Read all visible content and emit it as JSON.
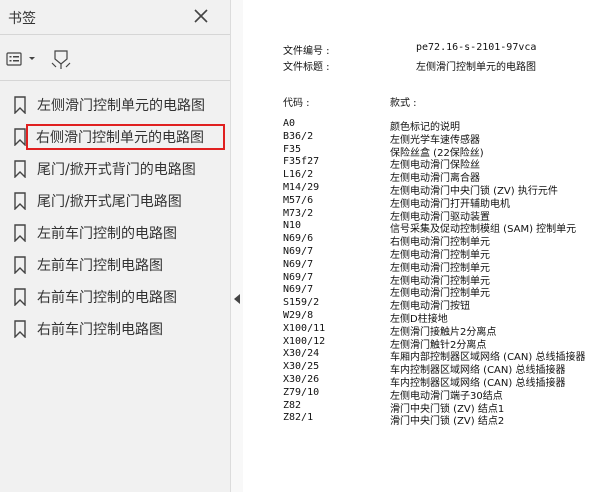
{
  "sidebar": {
    "title": "书签",
    "bookmarks": [
      {
        "label": "左侧滑门控制单元的电路图",
        "selected": false
      },
      {
        "label": "右侧滑门控制单元的电路图",
        "selected": true
      },
      {
        "label": "尾门/掀开式背门的电路图",
        "selected": false
      },
      {
        "label": "尾门/掀开式尾门电路图",
        "selected": false
      },
      {
        "label": "左前车门控制的电路图",
        "selected": false
      },
      {
        "label": "左前车门控制电路图",
        "selected": false
      },
      {
        "label": "右前车门控制的电路图",
        "selected": false
      },
      {
        "label": "右前车门控制电路图",
        "selected": false
      }
    ]
  },
  "document": {
    "file_number_label": "文件编号 :",
    "file_number": "pe72.16-s-2101-97vca",
    "file_title_label": "文件标题 :",
    "file_title": "左侧滑门控制单元的电路图",
    "code_header": "代码 :",
    "desc_header": "款式 :",
    "rows": [
      {
        "code": "A0",
        "desc": "颜色标记的说明"
      },
      {
        "code": "B36/2",
        "desc": "左侧光学车速传感器"
      },
      {
        "code": "F35",
        "desc": "保险丝盒 (22保险丝)"
      },
      {
        "code": "F35f27",
        "desc": "左侧电动滑门保险丝"
      },
      {
        "code": "L16/2",
        "desc": "左侧电动滑门离合器"
      },
      {
        "code": "M14/29",
        "desc": "左侧电动滑门中央门锁 (ZV) 执行元件"
      },
      {
        "code": "M57/6",
        "desc": "左侧电动滑门打开辅助电机"
      },
      {
        "code": "M73/2",
        "desc": "左侧电动滑门驱动装置"
      },
      {
        "code": "N10",
        "desc": "信号采集及促动控制模组 (SAM) 控制单元"
      },
      {
        "code": "N69/6",
        "desc": "右侧电动滑门控制单元"
      },
      {
        "code": "N69/7",
        "desc": "左侧电动滑门控制单元"
      },
      {
        "code": "N69/7",
        "desc": "左侧电动滑门控制单元"
      },
      {
        "code": "N69/7",
        "desc": "左侧电动滑门控制单元"
      },
      {
        "code": "N69/7",
        "desc": "左侧电动滑门控制单元"
      },
      {
        "code": "S159/2",
        "desc": "左侧电动滑门按钮"
      },
      {
        "code": "W29/8",
        "desc": "左侧D柱接地"
      },
      {
        "code": "X100/11",
        "desc": "左侧滑门接触片2分离点"
      },
      {
        "code": "X100/12",
        "desc": "左侧滑门触针2分离点"
      },
      {
        "code": "X30/24",
        "desc": "车厢内部控制器区域网络 (CAN) 总线插接器"
      },
      {
        "code": "X30/25",
        "desc": "车内控制器区域网络 (CAN) 总线插接器"
      },
      {
        "code": "X30/26",
        "desc": "车内控制器区域网络 (CAN) 总线插接器"
      },
      {
        "code": "Z79/10",
        "desc": "左侧电动滑门端子30结点"
      },
      {
        "code": "Z82",
        "desc": "滑门中央门锁 (ZV) 结点1"
      },
      {
        "code": "Z82/1",
        "desc": "滑门中央门锁 (ZV) 结点2"
      }
    ]
  },
  "colors": {
    "selection_border": "#e02020",
    "sidebar_bg": "#f1f1f1"
  }
}
